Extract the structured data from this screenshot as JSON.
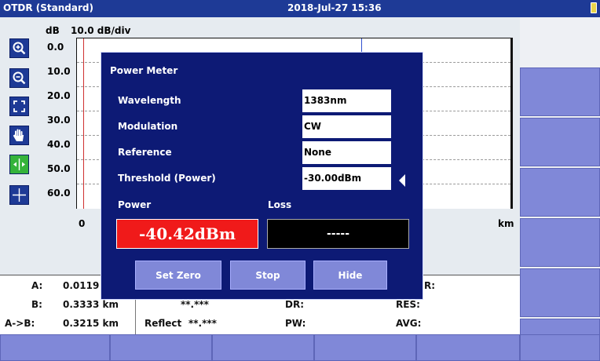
{
  "title_bar": {
    "app_name": "OTDR (Standard)",
    "datetime": "2018-Jul-27 15:36",
    "battery_color": "#e8d44a"
  },
  "toolbar": {
    "tools": [
      {
        "name": "zoom-in-icon",
        "active": false
      },
      {
        "name": "zoom-out-icon",
        "active": false
      },
      {
        "name": "fit-to-screen-icon",
        "active": false
      },
      {
        "name": "pan-hand-icon",
        "active": false
      },
      {
        "name": "marker-move-icon",
        "active": true
      },
      {
        "name": "crosshair-icon",
        "active": false
      }
    ]
  },
  "graph": {
    "y_unit": "dB",
    "scale": "10.0 dB/div",
    "y_ticks": [
      "0.0",
      "10.0",
      "20.0",
      "30.0",
      "40.0",
      "50.0",
      "60.0"
    ],
    "x_start": "0",
    "x_unit": "km"
  },
  "info_panel": {
    "a_label": "A:",
    "a_value": "0.0119",
    "b_label": "B:",
    "b_value": "0.3333 km",
    "ab_label": "A->B:",
    "ab_value": "0.3215 km",
    "mid_value": "**.***",
    "reflect_label": "Reflect",
    "reflect_value": "**.***",
    "r_label": "R:",
    "dr_label": "DR:",
    "res_label": "RES:",
    "pw_label": "PW:",
    "avg_label": "AVG:"
  },
  "dialog": {
    "title": "Power Meter",
    "wavelength_label": "Wavelength",
    "wavelength_value": "1383nm",
    "modulation_label": "Modulation",
    "modulation_value": "CW",
    "reference_label": "Reference",
    "reference_value": "None",
    "threshold_label": "Threshold (Power)",
    "threshold_value": "-30.00dBm",
    "power_label": "Power",
    "loss_label": "Loss",
    "power_value": "-40.42dBm",
    "loss_value": "-----",
    "set_zero_label": "Set Zero",
    "stop_label": "Stop",
    "hide_label": "Hide"
  },
  "colors": {
    "title_bar": "#1e3a96",
    "dialog_bg": "#0d1a75",
    "soft_key": "#8088d8",
    "power_alarm": "#f01a1a",
    "active_tool": "#35b33a"
  }
}
